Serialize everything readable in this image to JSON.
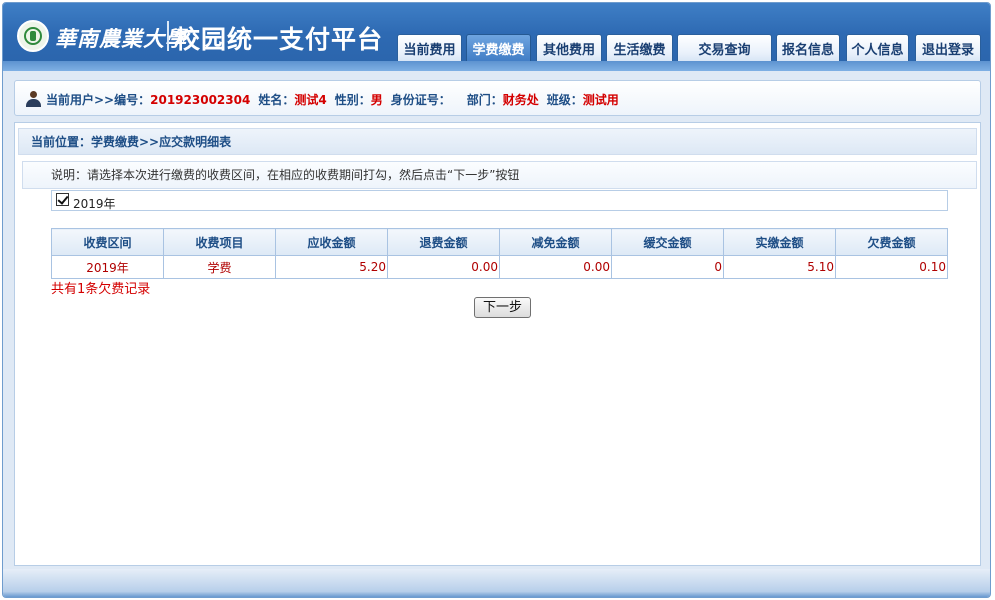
{
  "header": {
    "university_name": "華南農業大學",
    "platform_title": "校园统一支付平台"
  },
  "nav": {
    "items": [
      {
        "label": "当前费用",
        "active": false
      },
      {
        "label": "学费缴费",
        "active": true
      },
      {
        "label": "其他费用",
        "active": false
      },
      {
        "label": "生活缴费",
        "active": false
      },
      {
        "label": "交易查询",
        "active": false
      },
      {
        "label": "报名信息",
        "active": false
      },
      {
        "label": "个人信息",
        "active": false
      },
      {
        "label": "退出登录",
        "active": false
      }
    ]
  },
  "user": {
    "prefix": "当前用户>>编号：",
    "id": "201923002304",
    "name_label": "姓名：",
    "name": "测试4",
    "gender_label": "性别：",
    "gender": "男",
    "idcard_label": "身份证号：",
    "idcard": "",
    "dept_label": "部门：",
    "dept": "财务处",
    "class_label": "班级：",
    "class": "测试用"
  },
  "breadcrumb": "当前位置：学费缴费>>应交款明细表",
  "instruction": "说明：请选择本次进行缴费的收费区间，在相应的收费期间打勾，然后点击“下一步”按钮",
  "period": {
    "label": "2019年",
    "checked": true
  },
  "table": {
    "headers": [
      "收费区间",
      "收费项目",
      "应收金额",
      "退费金额",
      "减免金额",
      "缓交金额",
      "实缴金额",
      "欠费金额"
    ],
    "rows": [
      [
        "2019年",
        "学费",
        "5.20",
        "0.00",
        "0.00",
        "0",
        "5.10",
        "0.10"
      ]
    ]
  },
  "summary": "共有1条欠费记录",
  "next_button": "下一步",
  "colors": {
    "header_blue": "#2e6ab3",
    "label_blue": "#1e4e86",
    "value_red": "#d40000"
  }
}
